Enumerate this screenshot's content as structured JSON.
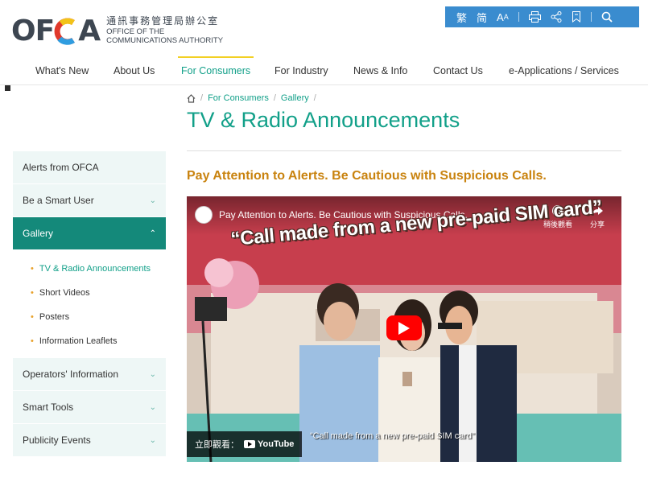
{
  "header": {
    "logo_zh": "通訊事務管理局辦公室",
    "logo_en_line1": "OFFICE OF THE",
    "logo_en_line2": "COMMUNICATIONS AUTHORITY",
    "logo_mark_left": "OF",
    "logo_mark_right": "A",
    "utility": {
      "traditional": "繁",
      "simplified": "简",
      "font_size": "A"
    }
  },
  "nav": {
    "items": [
      {
        "label": "What's New"
      },
      {
        "label": "About Us"
      },
      {
        "label": "For Consumers"
      },
      {
        "label": "For Industry"
      },
      {
        "label": "News & Info"
      },
      {
        "label": "Contact Us"
      },
      {
        "label": "e-Applications / Services"
      }
    ],
    "active_index": 2
  },
  "breadcrumb": {
    "items": [
      "For Consumers",
      "Gallery"
    ],
    "separator": "/"
  },
  "page_title": "TV & Radio Announcements",
  "sidebar": {
    "items": [
      {
        "label": "Alerts from OFCA"
      },
      {
        "label": "Be a Smart User"
      },
      {
        "label": "Gallery"
      },
      {
        "label": "Operators' Information"
      },
      {
        "label": "Smart Tools"
      },
      {
        "label": "Publicity Events"
      }
    ],
    "gallery_children": [
      {
        "label": "TV & Radio Announcements"
      },
      {
        "label": "Short Videos"
      },
      {
        "label": "Posters"
      },
      {
        "label": "Information Leaflets"
      }
    ],
    "chevron_down": "⌄",
    "chevron_up": "⌃"
  },
  "content": {
    "subhead": "Pay Attention to Alerts. Be Cautious with Suspicious Calls.",
    "video": {
      "title": "Pay Attention to Alerts. Be Cautious with Suspicious Calls.",
      "headline": "“Call made from a new pre-paid SIM card”",
      "caption": "“Call made from a new pre-paid SIM card”",
      "watch_later": "稍後觀看",
      "share": "分享",
      "watch_on": "立即觀看：",
      "youtube": "YouTube"
    }
  },
  "colors": {
    "accent": "#12a089",
    "sidebar_active": "#14897a",
    "subhead": "#c9830f",
    "utility_bar": "#3a8ccf",
    "nav_active_bar": "#f2d024"
  }
}
